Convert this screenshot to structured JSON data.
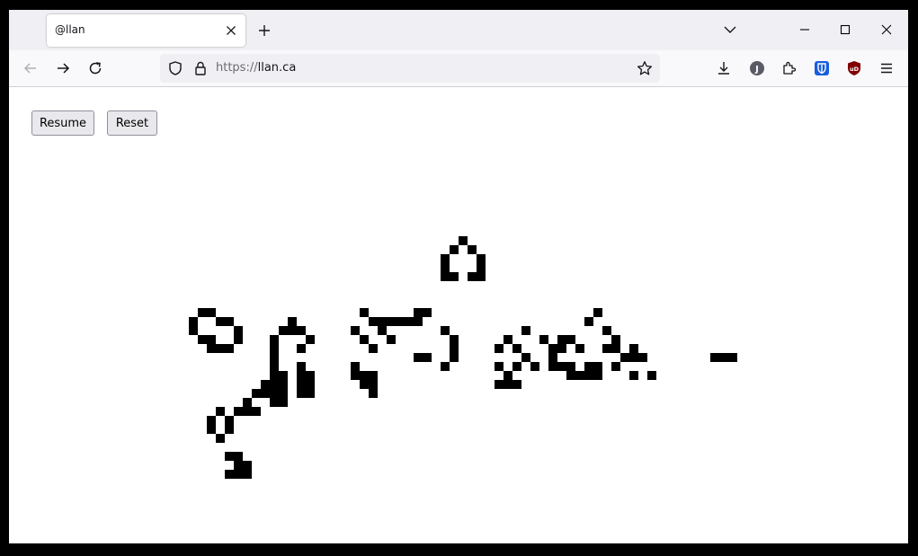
{
  "browser": {
    "tab": {
      "title": "@llan"
    },
    "url": {
      "protocol": "https://",
      "host": "llan.ca"
    }
  },
  "page": {
    "resume_label": "Resume",
    "reset_label": "Reset"
  },
  "icons": {
    "new_tab": "plus-icon",
    "tab_list": "chevron-down-icon",
    "back": "back-arrow-icon",
    "forward": "forward-arrow-icon",
    "reload": "reload-icon",
    "shield": "shield-icon",
    "lock": "lock-icon",
    "bookmark": "star-icon",
    "downloads": "download-icon",
    "account": "account-avatar-icon",
    "extensions": "puzzle-icon",
    "bitwarden": "bitwarden-icon",
    "ublock": "ublock-icon",
    "menu": "hamburger-menu-icon"
  },
  "colors": {
    "cell": "#000000",
    "bitwarden": "#175ddc",
    "ublock": "#800000",
    "account": "#5b5b66"
  },
  "life_grid": {
    "cell_unit": "1 cell",
    "live_cells": [
      [
        21,
        20
      ],
      [
        22,
        20
      ],
      [
        20,
        21
      ],
      [
        23,
        21
      ],
      [
        24,
        21
      ],
      [
        20,
        22
      ],
      [
        25,
        22
      ],
      [
        21,
        23
      ],
      [
        22,
        23
      ],
      [
        25,
        23
      ],
      [
        22,
        24
      ],
      [
        23,
        24
      ],
      [
        24,
        24
      ],
      [
        31,
        21
      ],
      [
        30,
        22
      ],
      [
        31,
        22
      ],
      [
        32,
        22
      ],
      [
        29,
        23
      ],
      [
        33,
        23
      ],
      [
        29,
        24
      ],
      [
        32,
        24
      ],
      [
        29,
        25
      ],
      [
        29,
        26
      ],
      [
        32,
        26
      ],
      [
        29,
        27
      ],
      [
        30,
        27
      ],
      [
        32,
        27
      ],
      [
        33,
        27
      ],
      [
        28,
        28
      ],
      [
        29,
        28
      ],
      [
        30,
        28
      ],
      [
        32,
        28
      ],
      [
        33,
        28
      ],
      [
        27,
        29
      ],
      [
        28,
        29
      ],
      [
        29,
        29
      ],
      [
        30,
        29
      ],
      [
        32,
        29
      ],
      [
        33,
        29
      ],
      [
        26,
        30
      ],
      [
        29,
        30
      ],
      [
        30,
        30
      ],
      [
        25,
        31
      ],
      [
        26,
        31
      ],
      [
        27,
        31
      ],
      [
        38,
        22
      ],
      [
        39,
        20
      ],
      [
        40,
        21
      ],
      [
        41,
        21
      ],
      [
        42,
        21
      ],
      [
        43,
        21
      ],
      [
        41,
        22
      ],
      [
        45,
        21
      ],
      [
        44,
        21
      ],
      [
        45,
        20
      ],
      [
        46,
        20
      ],
      [
        42,
        23
      ],
      [
        39,
        23
      ],
      [
        40,
        24
      ],
      [
        38,
        26
      ],
      [
        38,
        27
      ],
      [
        39,
        27
      ],
      [
        40,
        27
      ],
      [
        39,
        28
      ],
      [
        40,
        28
      ],
      [
        40,
        29
      ],
      [
        45,
        25
      ],
      [
        46,
        25
      ],
      [
        50,
        12
      ],
      [
        49,
        13
      ],
      [
        51,
        13
      ],
      [
        48,
        14
      ],
      [
        52,
        14
      ],
      [
        48,
        15
      ],
      [
        52,
        15
      ],
      [
        48,
        16
      ],
      [
        49,
        16
      ],
      [
        52,
        16
      ],
      [
        51,
        16
      ],
      [
        48,
        22
      ],
      [
        49,
        23
      ],
      [
        49,
        24
      ],
      [
        49,
        25
      ],
      [
        48,
        26
      ],
      [
        55,
        23
      ],
      [
        56,
        24
      ],
      [
        54,
        24
      ],
      [
        54,
        26
      ],
      [
        56,
        26
      ],
      [
        55,
        27
      ],
      [
        54,
        28
      ],
      [
        55,
        28
      ],
      [
        56,
        28
      ],
      [
        57,
        25
      ],
      [
        57,
        22
      ],
      [
        58,
        26
      ],
      [
        59,
        23
      ],
      [
        60,
        24
      ],
      [
        61,
        24
      ],
      [
        60,
        25
      ],
      [
        60,
        26
      ],
      [
        61,
        26
      ],
      [
        62,
        26
      ],
      [
        63,
        27
      ],
      [
        62,
        27
      ],
      [
        61,
        23
      ],
      [
        62,
        23
      ],
      [
        63,
        24
      ],
      [
        65,
        20
      ],
      [
        64,
        21
      ],
      [
        66,
        22
      ],
      [
        67,
        23
      ],
      [
        66,
        24
      ],
      [
        67,
        24
      ],
      [
        68,
        25
      ],
      [
        69,
        25
      ],
      [
        70,
        25
      ],
      [
        69,
        24
      ],
      [
        64,
        26
      ],
      [
        65,
        26
      ],
      [
        64,
        27
      ],
      [
        65,
        27
      ],
      [
        67,
        26
      ],
      [
        69,
        27
      ],
      [
        71,
        27
      ],
      [
        78,
        25
      ],
      [
        79,
        25
      ],
      [
        80,
        25
      ],
      [
        23,
        31
      ],
      [
        22,
        32
      ],
      [
        24,
        32
      ],
      [
        22,
        33
      ],
      [
        24,
        33
      ],
      [
        23,
        34
      ],
      [
        24,
        36
      ],
      [
        25,
        36
      ],
      [
        25,
        37
      ],
      [
        24,
        38
      ],
      [
        25,
        38
      ],
      [
        26,
        37
      ],
      [
        26,
        38
      ]
    ]
  }
}
